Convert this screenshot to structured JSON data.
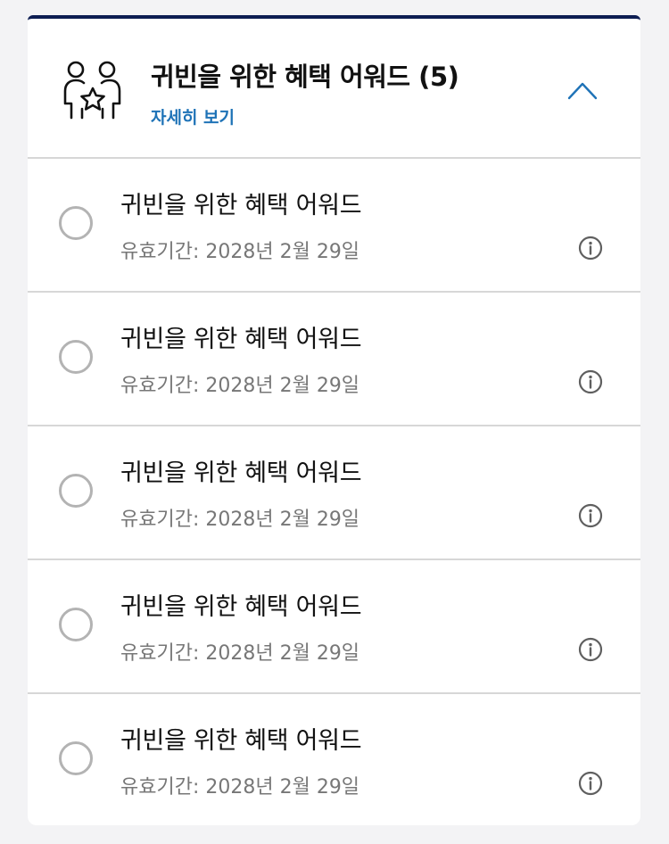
{
  "header": {
    "title": "귀빈을 위한 혜택 어워드 (5)",
    "details_link": "자세히 보기",
    "icon": "people-star-icon",
    "collapse_icon": "chevron-up-icon"
  },
  "colors": {
    "accent_bar": "#0d1d52",
    "link": "#1f73b7",
    "chevron": "#1f73b7",
    "divider": "#d7d7d7"
  },
  "items": [
    {
      "title": "귀빈을 위한 혜택 어워드",
      "validity": "유효기간: 2028년 2월 29일"
    },
    {
      "title": "귀빈을 위한 혜택 어워드",
      "validity": "유효기간: 2028년 2월 29일"
    },
    {
      "title": "귀빈을 위한 혜택 어워드",
      "validity": "유효기간: 2028년 2월 29일"
    },
    {
      "title": "귀빈을 위한 혜택 어워드",
      "validity": "유효기간: 2028년 2월 29일"
    },
    {
      "title": "귀빈을 위한 혜택 어워드",
      "validity": "유효기간: 2028년 2월 29일"
    }
  ]
}
